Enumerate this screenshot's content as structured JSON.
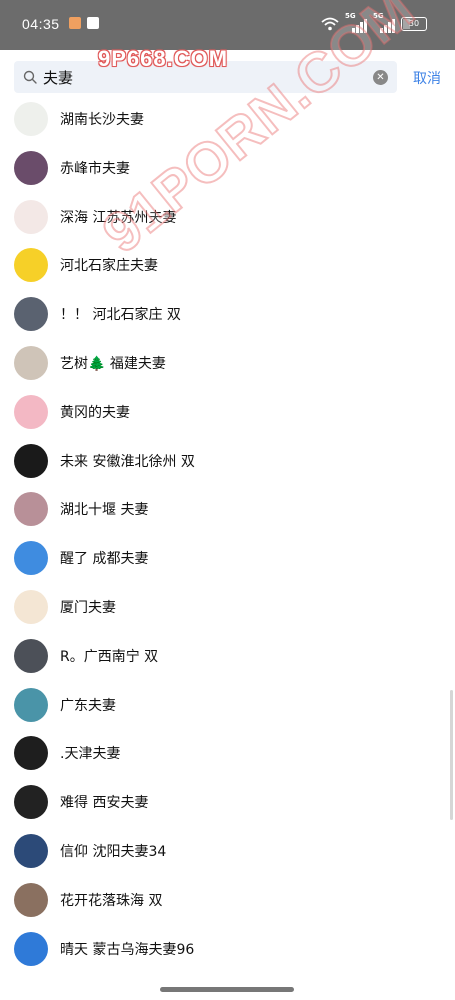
{
  "status_bar": {
    "time": "04:35",
    "signal_1_label": "5G",
    "signal_2_label": "5G",
    "battery": "30"
  },
  "watermark": {
    "top": "9P668.COM",
    "diagonal": "91PORN.COM"
  },
  "search": {
    "value": "夫妻",
    "placeholder": "",
    "cancel_label": "取消"
  },
  "contacts": [
    {
      "name": "湖南长沙夫妻",
      "avatar_color": "#eef0ec"
    },
    {
      "name": "赤峰市夫妻",
      "avatar_color": "#6a4c6a"
    },
    {
      "name": "深海 江苏苏州夫妻",
      "avatar_color": "#f3e8e6"
    },
    {
      "name": "河北石家庄夫妻",
      "avatar_color": "#f6d028"
    },
    {
      "name": "！！ 河北石家庄 双",
      "avatar_color": "#5a6270"
    },
    {
      "name": "艺树🌲 福建夫妻",
      "avatar_color": "#cfc4b8"
    },
    {
      "name": "黄冈的夫妻",
      "avatar_color": "#f3b8c4"
    },
    {
      "name": "未来 安徽淮北徐州 双",
      "avatar_color": "#1a1a1a"
    },
    {
      "name": "湖北十堰 夫妻",
      "avatar_color": "#b89098"
    },
    {
      "name": "醒了 成都夫妻",
      "avatar_color": "#3f8ce0"
    },
    {
      "name": "厦门夫妻",
      "avatar_color": "#f4e6d4"
    },
    {
      "name": "R。广西南宁 双",
      "avatar_color": "#4c5058"
    },
    {
      "name": "广东夫妻",
      "avatar_color": "#4a94a8"
    },
    {
      "name": ".天津夫妻",
      "avatar_color": "#1e1e1e"
    },
    {
      "name": "难得  西安夫妻",
      "avatar_color": "#222222"
    },
    {
      "name": "信仰 沈阳夫妻34",
      "avatar_color": "#2c4a78"
    },
    {
      "name": "花开花落珠海 双",
      "avatar_color": "#8a7060"
    },
    {
      "name": "晴天   蒙古乌海夫妻96",
      "avatar_color": "#2f7ad8"
    }
  ]
}
